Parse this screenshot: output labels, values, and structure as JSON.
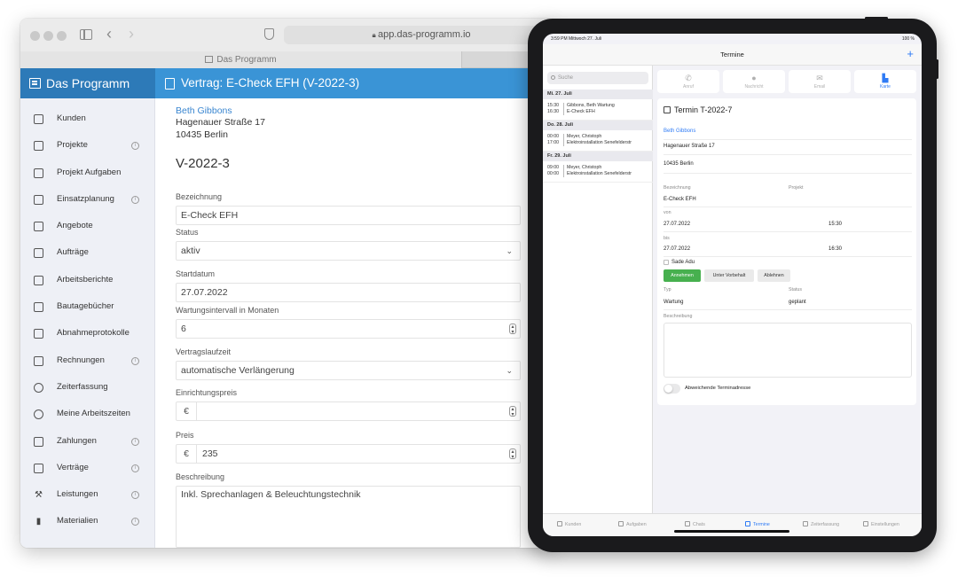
{
  "browser": {
    "url": "app.das-programm.io",
    "tab_title": "Das Programm"
  },
  "sidebar": {
    "brand": "Das Programm",
    "items": [
      {
        "label": "Kunden",
        "icon": "person-card-icon",
        "info": false
      },
      {
        "label": "Projekte",
        "icon": "network-icon",
        "info": true
      },
      {
        "label": "Projekt Aufgaben",
        "icon": "checklist-icon",
        "info": false
      },
      {
        "label": "Einsatzplanung",
        "icon": "calendar-icon",
        "info": true
      },
      {
        "label": "Angebote",
        "icon": "calculator-icon",
        "info": false
      },
      {
        "label": "Aufträge",
        "icon": "handshake-icon",
        "info": false
      },
      {
        "label": "Arbeitsberichte",
        "icon": "report-icon",
        "info": false
      },
      {
        "label": "Bautagebücher",
        "icon": "book-icon",
        "info": false
      },
      {
        "label": "Abnahmeprotokolle",
        "icon": "signature-icon",
        "info": false
      },
      {
        "label": "Rechnungen",
        "icon": "invoice-icon",
        "info": true
      },
      {
        "label": "Zeiterfassung",
        "icon": "clock-icon",
        "info": false
      },
      {
        "label": "Meine Arbeitszeiten",
        "icon": "clock-icon",
        "info": false
      },
      {
        "label": "Zahlungen",
        "icon": "cash-register-icon",
        "info": true
      },
      {
        "label": "Verträge",
        "icon": "contract-icon",
        "info": true
      },
      {
        "label": "Leistungen",
        "icon": "wrench-icon",
        "info": true
      },
      {
        "label": "Materialien",
        "icon": "barcode-icon",
        "info": true
      }
    ]
  },
  "main": {
    "header": "Vertrag: E-Check EFH (V-2022-3)",
    "customer_name": "Beth Gibbons",
    "street": "Hagenauer Straße 17",
    "city": "10435 Berlin",
    "contract_number": "V-2022-3",
    "fields": {
      "bezeichnung_label": "Bezeichnung",
      "bezeichnung_value": "E-Check EFH",
      "status_label": "Status",
      "status_value": "aktiv",
      "startdatum_label": "Startdatum",
      "startdatum_value": "27.07.2022",
      "wartung_label": "Wartungsintervall in Monaten",
      "wartung_value": "6",
      "laufzeit_label": "Vertragslaufzeit",
      "laufzeit_value": "automatische Verlängerung",
      "einrichtung_label": "Einrichtungspreis",
      "einrichtung_value": "",
      "currency": "€",
      "preis_label": "Preis",
      "preis_value": "235",
      "beschreibung_label": "Beschreibung",
      "beschreibung_value": "Inkl. Sprechanlagen & Beleuchtungstechnik"
    }
  },
  "ipad": {
    "status_left": "3:59 PM   Mittwoch 27. Juli",
    "status_right": "100 %",
    "nav_title": "Termine",
    "nav_plus": "+",
    "search_placeholder": "Suche",
    "days": [
      {
        "header": "Mi. 27. Juli",
        "appts": [
          {
            "time1": "15:30",
            "time2": "16:30",
            "line1": "Gibbons, Beth Wartung",
            "line2": "E-Check EFH"
          }
        ]
      },
      {
        "header": "Do. 28. Juli",
        "appts": [
          {
            "time1": "00:00",
            "time2": "17:00",
            "line1": "Meyer, Christoph",
            "line2": "Elektroinstallation Senefelderstr"
          }
        ]
      },
      {
        "header": "Fr. 29. Juli",
        "appts": [
          {
            "time1": "09:00",
            "time2": "00:00",
            "line1": "Meyer, Christoph",
            "line2": "Elektroinstallation Senefelderstr"
          }
        ]
      }
    ],
    "actions": [
      {
        "label": "Anruf",
        "icon": "phone-icon",
        "glyph": "✆"
      },
      {
        "label": "Nachricht",
        "icon": "message-icon",
        "glyph": "●"
      },
      {
        "label": "Email",
        "icon": "mail-icon",
        "glyph": "✉"
      },
      {
        "label": "Karte",
        "icon": "map-icon",
        "glyph": "▙"
      }
    ],
    "detail": {
      "title": "Termin T-2022-7",
      "customer": "Beth Gibbons",
      "street": "Hagenauer Straße 17",
      "city": "10435 Berlin",
      "bezeichnung_label": "Bezeichnung",
      "projekt_label": "Projekt",
      "bezeichnung_value": "E-Check EFH",
      "von_label": "von",
      "von_date": "27.07.2022",
      "von_time": "15:30",
      "bis_label": "bis",
      "bis_date": "27.07.2022",
      "bis_time": "16:30",
      "participant": "Sade Adu",
      "btn_accept": "Annehmen",
      "btn_reserve": "Unter Vorbehalt",
      "btn_decline": "Ablehnen",
      "typ_label": "Typ",
      "status_label": "Status",
      "typ_value": "Wartung",
      "status_value": "geplant",
      "beschreibung_label": "Beschreibung",
      "address_toggle_label": "Abweichende Terminadresse"
    },
    "tabs": [
      {
        "label": "Kunden",
        "active": false
      },
      {
        "label": "Aufgaben",
        "active": false
      },
      {
        "label": "Chats",
        "active": false
      },
      {
        "label": "Termine",
        "active": true
      },
      {
        "label": "Zeiterfassung",
        "active": false
      },
      {
        "label": "Einstellungen",
        "active": false
      }
    ]
  },
  "colors": {
    "brand_dark": "#2d7ab8",
    "brand": "#3a94d6",
    "ios_blue": "#2f7bf5",
    "accept_green": "#47b04f"
  }
}
